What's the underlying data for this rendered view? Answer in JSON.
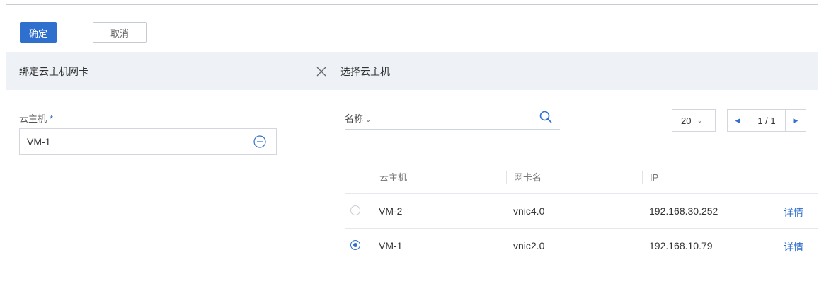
{
  "toolbar": {
    "confirm_label": "确定",
    "cancel_label": "取消"
  },
  "left_panel": {
    "title": "绑定云主机网卡",
    "vm_field_label": "云主机",
    "required_mark": "*",
    "vm_value": "VM-1",
    "remove_icon": "minus-circle-icon"
  },
  "right_panel": {
    "title": "选择云主机",
    "close_icon": "close-icon",
    "search": {
      "field_label": "名称",
      "value": "",
      "icon": "search-icon"
    },
    "page_size": "20",
    "page_indicator": "1 / 1",
    "columns": [
      "云主机",
      "网卡名",
      "IP"
    ],
    "rows": [
      {
        "selected": false,
        "vm": "VM-2",
        "nic": "vnic4.0",
        "ip": "192.168.30.252",
        "action": "详情"
      },
      {
        "selected": true,
        "vm": "VM-1",
        "nic": "vnic2.0",
        "ip": "192.168.10.79",
        "action": "详情"
      }
    ]
  },
  "colors": {
    "accent": "#2f6fcd",
    "header_bg": "#eef2f7",
    "border": "#e4e7ec"
  }
}
